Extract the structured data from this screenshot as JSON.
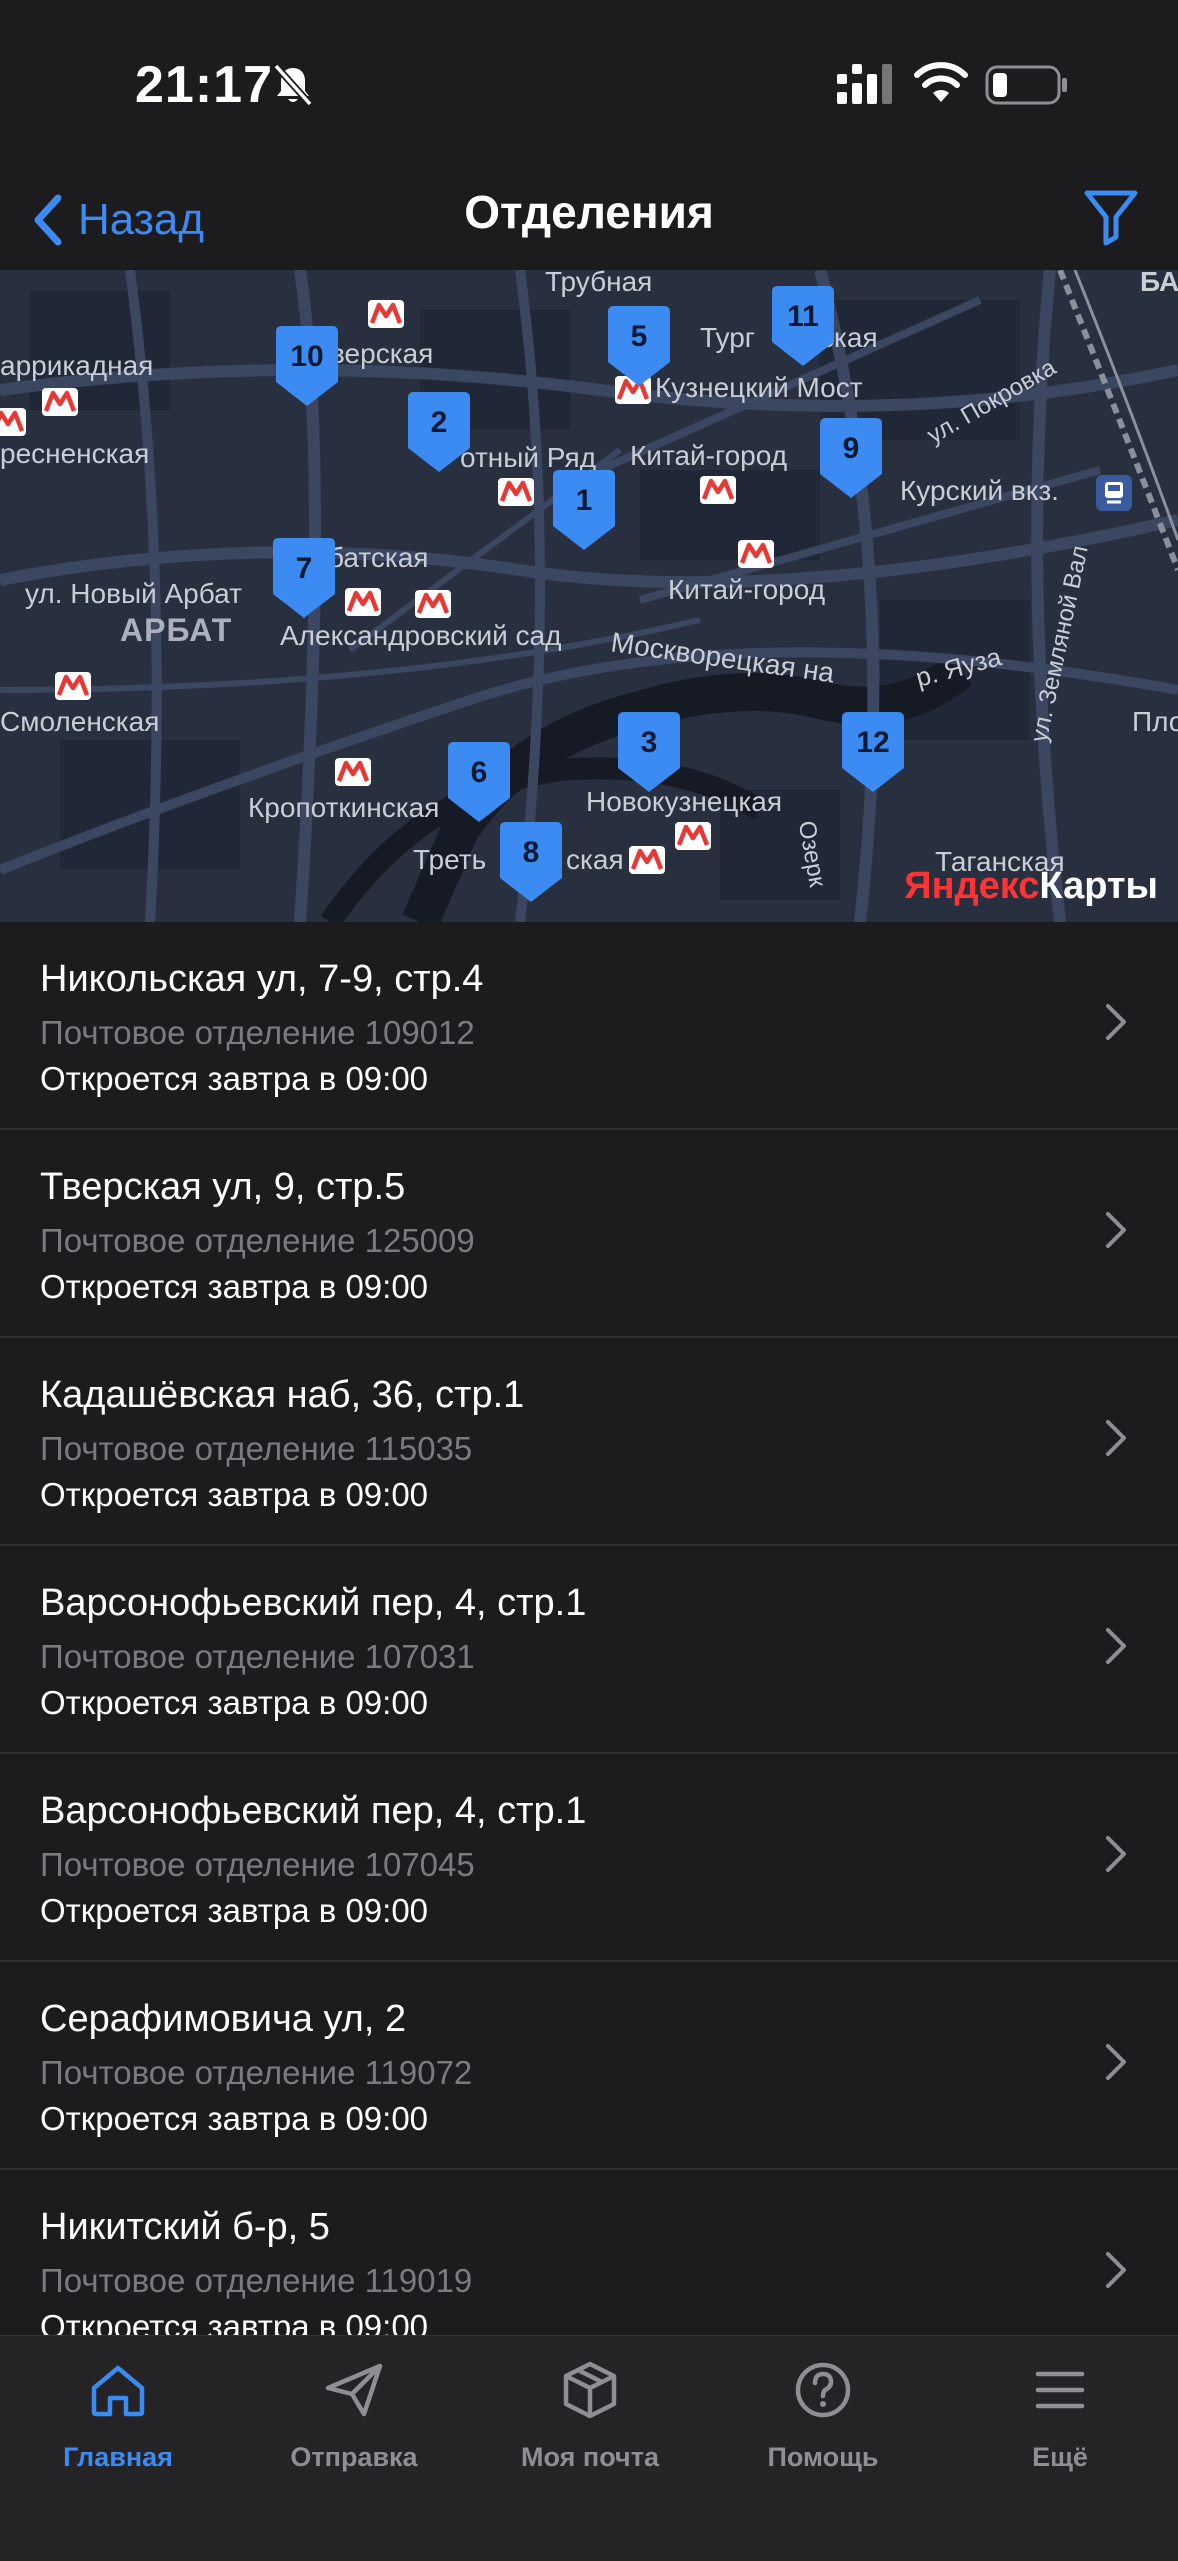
{
  "status_bar": {
    "time": "21:17"
  },
  "nav": {
    "back_label": "Назад",
    "title": "Отделения"
  },
  "map": {
    "attribution_part1": "Яндекс",
    "attribution_part2": "Карты",
    "labels": {
      "trubnaya": "Трубная",
      "tverskaya": "верская",
      "turg": "Тург",
      "skaya": "ская",
      "barrikadnaya": "аррикадная",
      "kuznetsky": "Кузнецкий Мост",
      "presnenskaya": "ресненская",
      "otny_ryad": "отный Ряд",
      "kitay_gorod1": "Китай-город",
      "pokrovka": "ул. Покровка",
      "kursky": "Курский вкз.",
      "arbatskaya": "батская",
      "novy_arbat": "ул. Новый Арбат",
      "arbat": "АРБАТ",
      "alexandrovsky": "Александровский сад",
      "kitay_gorod2": "Китай-город",
      "zemlyanoy": "ул. Земляной Вал",
      "moskvoretskaya": "Москворецкая на",
      "yauza": "р. Яуза",
      "smolenskaya": "Смоленская",
      "pl": "Пло",
      "kropotkinskaya": "Кропоткинская",
      "novokuznetskaya": "Новокузнецкая",
      "tretyakovskaya": "Треть",
      "tretyakovskaya2": "ская",
      "taganskaya": "Таганская",
      "ozerk": "Озерк",
      "ba": "БА"
    },
    "pins": [
      "1",
      "2",
      "3",
      "5",
      "6",
      "7",
      "8",
      "9",
      "10",
      "11",
      "12"
    ]
  },
  "offices": [
    {
      "address": "Никольская ул, 7-9, стр.4",
      "office": "Почтовое отделение 109012",
      "hours": "Откроется завтра в 09:00"
    },
    {
      "address": "Тверская ул, 9, стр.5",
      "office": "Почтовое отделение 125009",
      "hours": "Откроется завтра в 09:00"
    },
    {
      "address": "Кадашёвская наб, 36, стр.1",
      "office": "Почтовое отделение 115035",
      "hours": "Откроется завтра в 09:00"
    },
    {
      "address": "Варсонофьевский пер, 4, стр.1",
      "office": "Почтовое отделение 107031",
      "hours": "Откроется завтра в 09:00"
    },
    {
      "address": "Варсонофьевский пер, 4, стр.1",
      "office": "Почтовое отделение 107045",
      "hours": "Откроется завтра в 09:00"
    },
    {
      "address": "Серафимовича ул, 2",
      "office": "Почтовое отделение 119072",
      "hours": "Откроется завтра в 09:00"
    },
    {
      "address": "Никитский б-р, 5",
      "office": "Почтовое отделение 119019",
      "hours": "Откроется завтра в 09:00"
    }
  ],
  "tabbar": {
    "home": "Главная",
    "send": "Отправка",
    "mail": "Моя почта",
    "help": "Помощь",
    "more": "Ещё"
  },
  "colors": {
    "accent": "#3b8bf3",
    "background": "#1c1c1e",
    "pin": "#3b8bf3",
    "metro": "#e53935"
  }
}
